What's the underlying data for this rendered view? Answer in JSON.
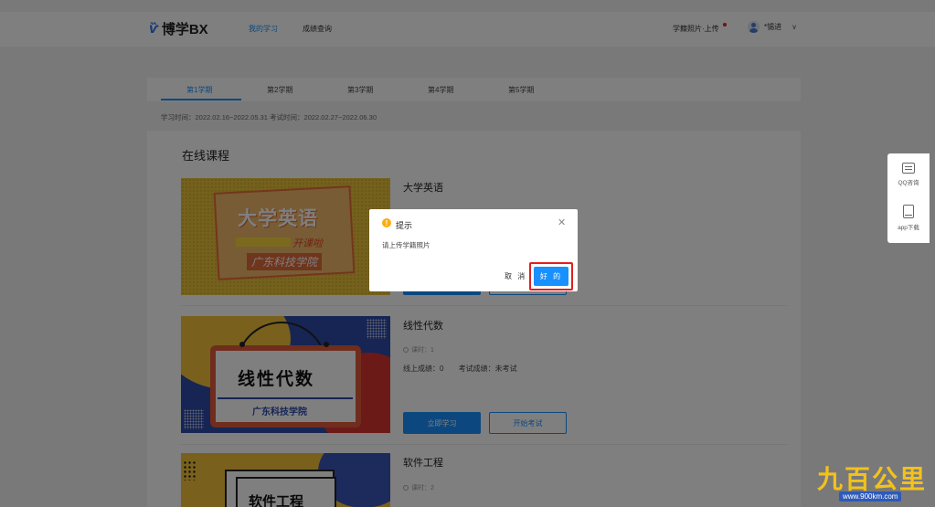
{
  "nav": {
    "logo_text": "博学BX",
    "links": [
      "我的学习",
      "成绩查询"
    ],
    "upload_label": "学籍照片·上传",
    "username": "*锡进"
  },
  "tabs": [
    "第1学期",
    "第2学期",
    "第3学期",
    "第4学期",
    "第5学期"
  ],
  "dates": "学习时间：2022.02.16~2022.05.31    考试时间：2022.02.27~2022.06.30",
  "section_title": "在线课程",
  "courses": [
    {
      "name": "大学英语",
      "img_title": "大学英语",
      "img_sub": "开课啦",
      "img_school": "广东科技学院"
    },
    {
      "name": "线性代数",
      "hours": "课时：1",
      "online_score": "线上成绩：0",
      "exam_score": "考试成绩：未考试",
      "btn_study": "立即学习",
      "btn_exam": "开始考试",
      "img_title": "线性代数",
      "img_school": "广东科技学院"
    },
    {
      "name": "软件工程",
      "hours": "课时：2",
      "img_title": "软件工程"
    }
  ],
  "float": {
    "qq_label": "QQ咨询",
    "app_label": "app下载"
  },
  "modal": {
    "title": "提示",
    "message": "请上传学籍照片",
    "cancel": "取 消",
    "ok": "好 的"
  },
  "watermark": {
    "text": "九百公里",
    "url": "www.900km.com"
  },
  "colors": {
    "primary": "#1890ff",
    "highlight": "#e02020",
    "warning": "#faad14"
  }
}
